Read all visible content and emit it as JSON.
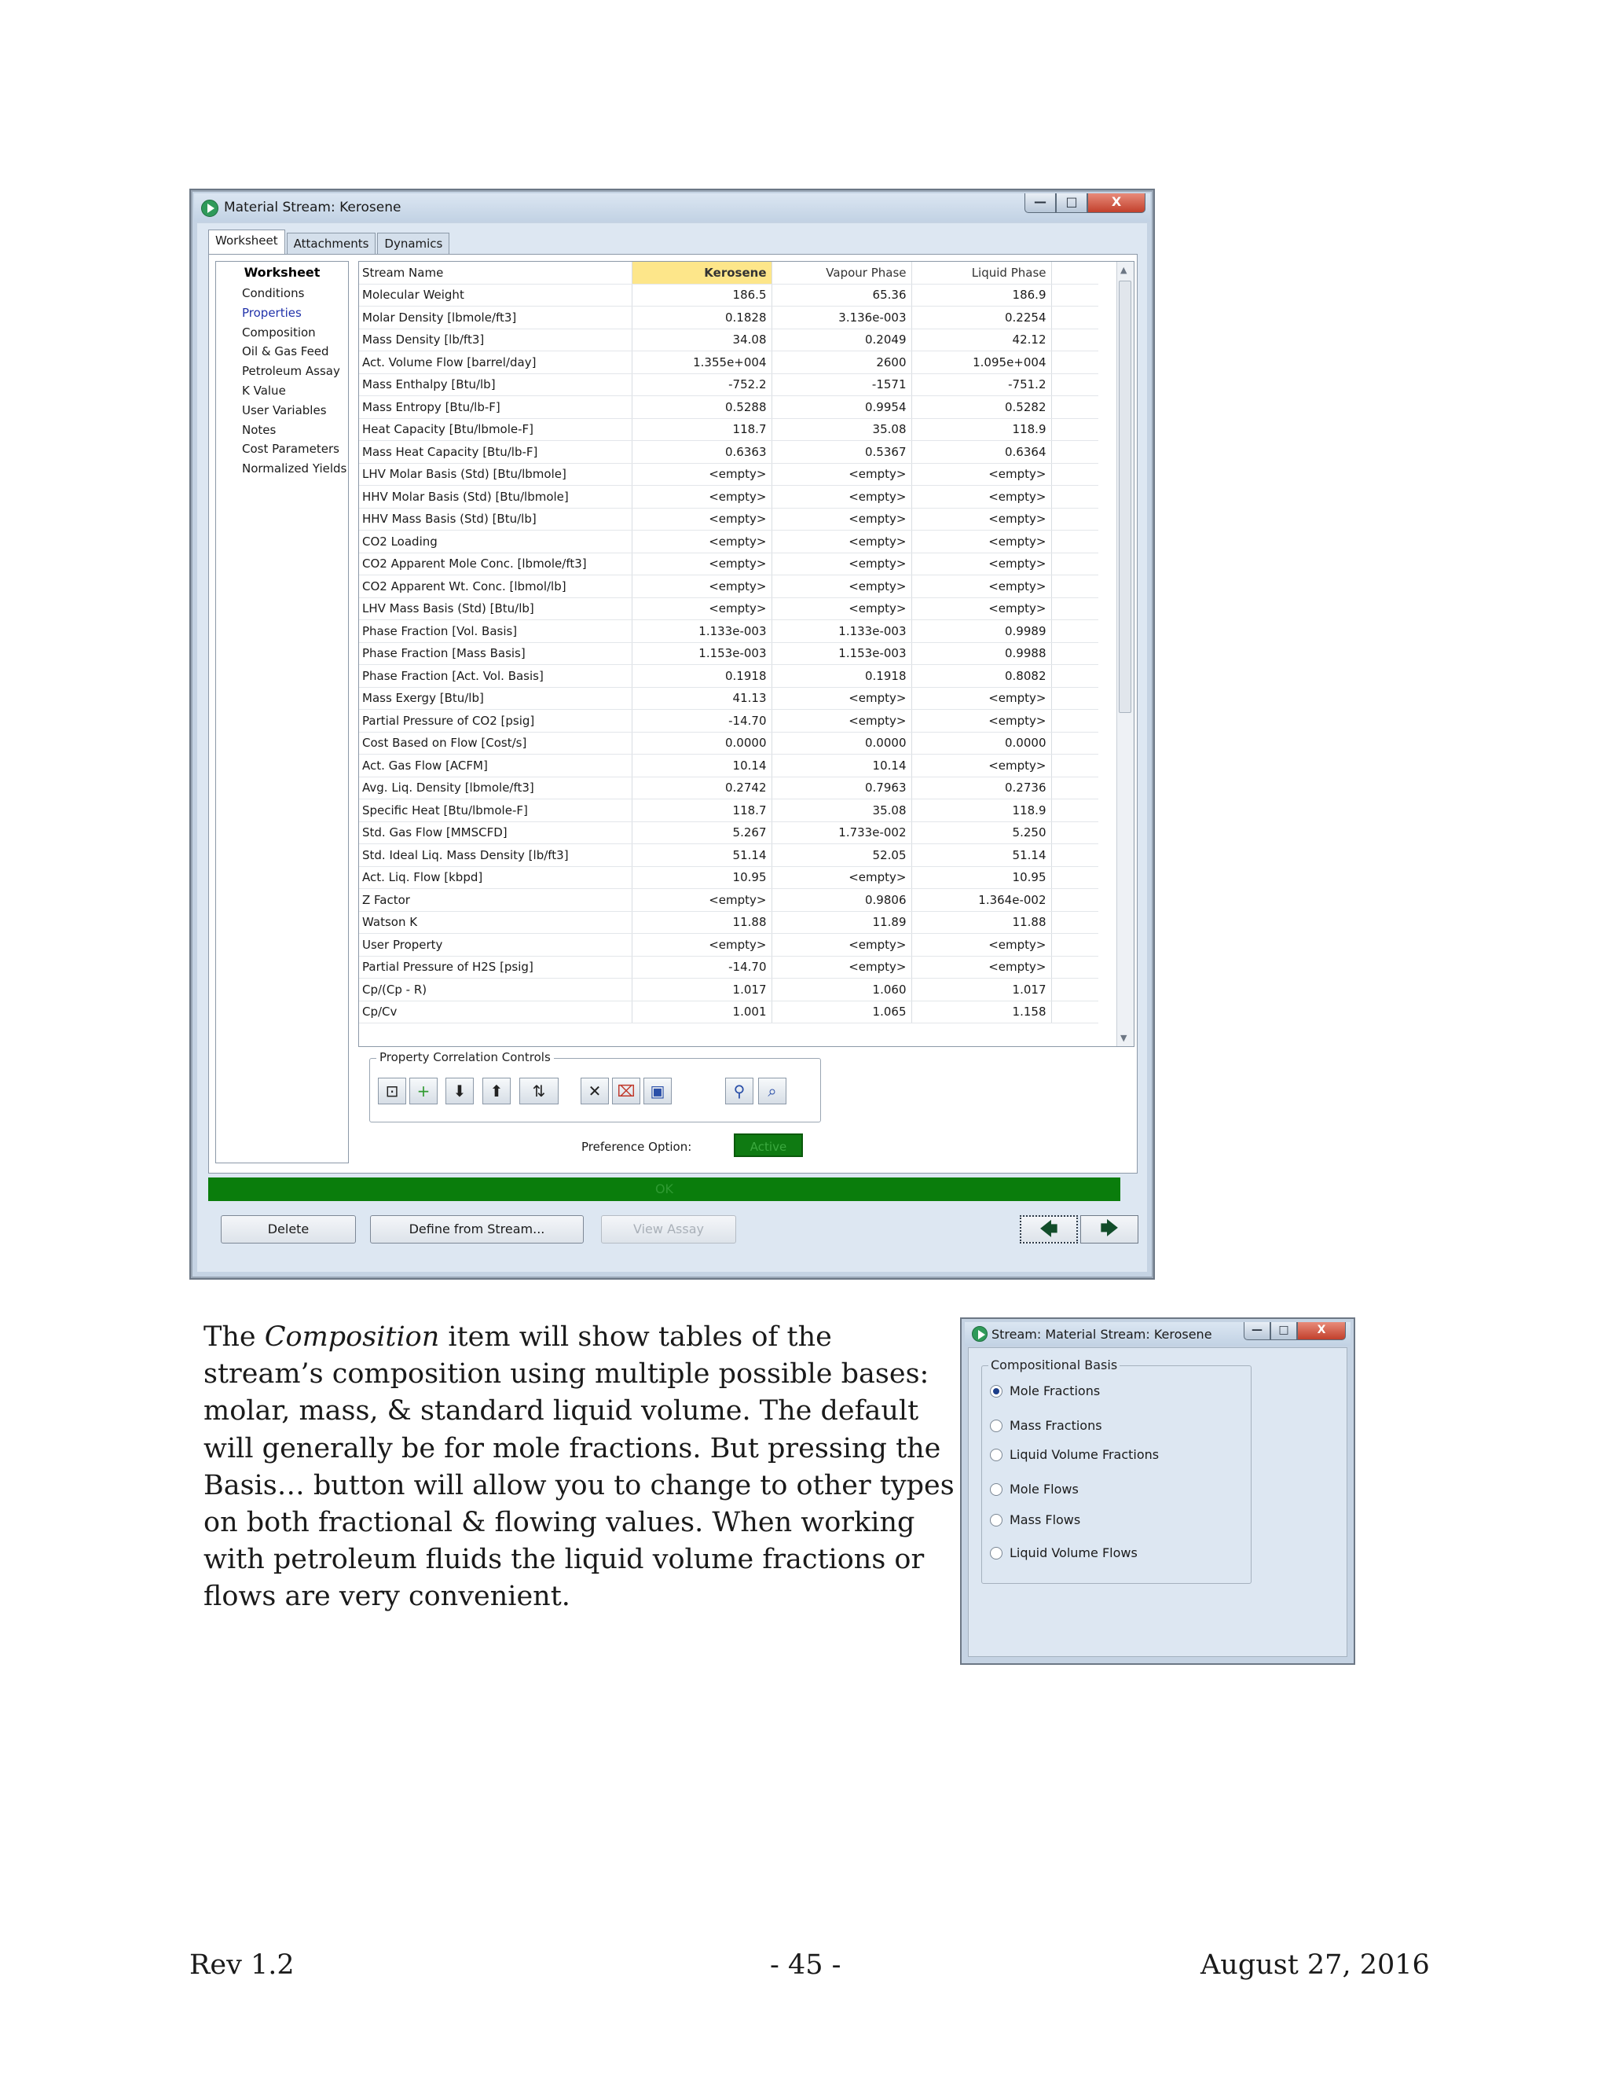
{
  "main_window": {
    "title": "Material Stream: Kerosene",
    "min_glyph": "—",
    "max_glyph": "□",
    "close_glyph": "X",
    "tabs": [
      "Worksheet",
      "Attachments",
      "Dynamics"
    ],
    "nav": {
      "heading": "Worksheet",
      "items": [
        "Conditions",
        "Properties",
        "Composition",
        "Oil & Gas Feed",
        "Petroleum Assay",
        "K Value",
        "User Variables",
        "Notes",
        "Cost Parameters",
        "Normalized Yields"
      ],
      "selected": "Properties"
    },
    "grid": {
      "headers": [
        "Stream Name",
        "Kerosene",
        "Vapour Phase",
        "Liquid Phase"
      ],
      "rows": [
        [
          "Molecular Weight",
          "186.5",
          "65.36",
          "186.9"
        ],
        [
          "Molar Density [lbmole/ft3]",
          "0.1828",
          "3.136e-003",
          "0.2254"
        ],
        [
          "Mass Density [lb/ft3]",
          "34.08",
          "0.2049",
          "42.12"
        ],
        [
          "Act. Volume Flow [barrel/day]",
          "1.355e+004",
          "2600",
          "1.095e+004"
        ],
        [
          "Mass Enthalpy [Btu/lb]",
          "-752.2",
          "-1571",
          "-751.2"
        ],
        [
          "Mass Entropy [Btu/lb-F]",
          "0.5288",
          "0.9954",
          "0.5282"
        ],
        [
          "Heat Capacity [Btu/lbmole-F]",
          "118.7",
          "35.08",
          "118.9"
        ],
        [
          "Mass Heat Capacity [Btu/lb-F]",
          "0.6363",
          "0.5367",
          "0.6364"
        ],
        [
          "LHV Molar Basis (Std) [Btu/lbmole]",
          "<empty>",
          "<empty>",
          "<empty>"
        ],
        [
          "HHV Molar Basis (Std) [Btu/lbmole]",
          "<empty>",
          "<empty>",
          "<empty>"
        ],
        [
          "HHV Mass Basis (Std) [Btu/lb]",
          "<empty>",
          "<empty>",
          "<empty>"
        ],
        [
          "CO2 Loading",
          "<empty>",
          "<empty>",
          "<empty>"
        ],
        [
          "CO2 Apparent Mole Conc. [lbmole/ft3]",
          "<empty>",
          "<empty>",
          "<empty>"
        ],
        [
          "CO2 Apparent Wt. Conc. [lbmol/lb]",
          "<empty>",
          "<empty>",
          "<empty>"
        ],
        [
          "LHV Mass Basis (Std) [Btu/lb]",
          "<empty>",
          "<empty>",
          "<empty>"
        ],
        [
          "Phase Fraction [Vol. Basis]",
          "1.133e-003",
          "1.133e-003",
          "0.9989"
        ],
        [
          "Phase Fraction [Mass Basis]",
          "1.153e-003",
          "1.153e-003",
          "0.9988"
        ],
        [
          "Phase Fraction [Act. Vol. Basis]",
          "0.1918",
          "0.1918",
          "0.8082"
        ],
        [
          "Mass Exergy [Btu/lb]",
          "41.13",
          "<empty>",
          "<empty>"
        ],
        [
          "Partial Pressure of CO2 [psig]",
          "-14.70",
          "<empty>",
          "<empty>"
        ],
        [
          "Cost Based on Flow [Cost/s]",
          "0.0000",
          "0.0000",
          "0.0000"
        ],
        [
          "Act. Gas Flow [ACFM]",
          "10.14",
          "10.14",
          "<empty>"
        ],
        [
          "Avg. Liq. Density [lbmole/ft3]",
          "0.2742",
          "0.7963",
          "0.2736"
        ],
        [
          "Specific Heat [Btu/lbmole-F]",
          "118.7",
          "35.08",
          "118.9"
        ],
        [
          "Std. Gas Flow [MMSCFD]",
          "5.267",
          "1.733e-002",
          "5.250"
        ],
        [
          "Std. Ideal Liq. Mass Density [lb/ft3]",
          "51.14",
          "52.05",
          "51.14"
        ],
        [
          "Act. Liq. Flow [kbpd]",
          "10.95",
          "<empty>",
          "10.95"
        ],
        [
          "Z Factor",
          "<empty>",
          "0.9806",
          "1.364e-002"
        ],
        [
          "Watson K",
          "11.88",
          "11.89",
          "11.88"
        ],
        [
          "User Property",
          "<empty>",
          "<empty>",
          "<empty>"
        ],
        [
          "Partial Pressure of H2S [psig]",
          "-14.70",
          "<empty>",
          "<empty>"
        ],
        [
          "Cp/(Cp - R)",
          "1.017",
          "1.060",
          "1.017"
        ],
        [
          "Cp/Cv",
          "1.001",
          "1.065",
          "1.158"
        ]
      ]
    },
    "property_correlation_controls": {
      "label": "Property Correlation Controls",
      "tools": [
        {
          "icon": "view-correlation-icon",
          "glyph": "⊡"
        },
        {
          "icon": "add-icon",
          "glyph": "+"
        },
        {
          "icon": "move-down-icon",
          "glyph": "⬇"
        },
        {
          "icon": "move-up-icon",
          "glyph": "⬆"
        },
        {
          "icon": "sort-az-icon",
          "glyph": "⇅"
        },
        {
          "icon": "delete-icon",
          "glyph": "✕"
        },
        {
          "icon": "clear-icon",
          "glyph": "⌧"
        },
        {
          "icon": "save-icon",
          "glyph": "▣"
        },
        {
          "icon": "find-icon",
          "glyph": "⚲"
        },
        {
          "icon": "find-replace-icon",
          "glyph": "⌕"
        }
      ]
    },
    "preference_option": {
      "label": "Preference Option:",
      "value": "Active"
    },
    "status": "OK",
    "buttons": {
      "delete": "Delete",
      "define_from_stream": "Define from Stream...",
      "view_assay": "View Assay"
    },
    "nav_arrows": {
      "prev": "🡄",
      "next": "🡆"
    },
    "colors": {
      "status_bar": "#0a7d0c",
      "highlight": "#fde68a",
      "selected_stream_text": "#1f2fbf"
    }
  },
  "paragraph": {
    "pre": "The ",
    "em": "Composition",
    "post": " item will show tables of the stream’s composition using multiple possible bases: molar, mass, & standard liquid volume. The default will generally be for mole fractions. But pressing the Basis… button will allow you to change to other types on both fractional & flowing values. When working with petroleum fluids the liquid volume fractions or flows are very convenient."
  },
  "basis_window": {
    "title": "Stream: Material Stream: Kerosene",
    "group_label": "Compositional Basis",
    "options": [
      "Mole Fractions",
      "Mass Fractions",
      "Liquid Volume Fractions",
      "Mole Flows",
      "Mass Flows",
      "Liquid Volume Flows"
    ],
    "selected": "Mole Fractions"
  },
  "footer": {
    "left": "Rev 1.2",
    "center": "- 45 -",
    "right": "August 27, 2016"
  }
}
